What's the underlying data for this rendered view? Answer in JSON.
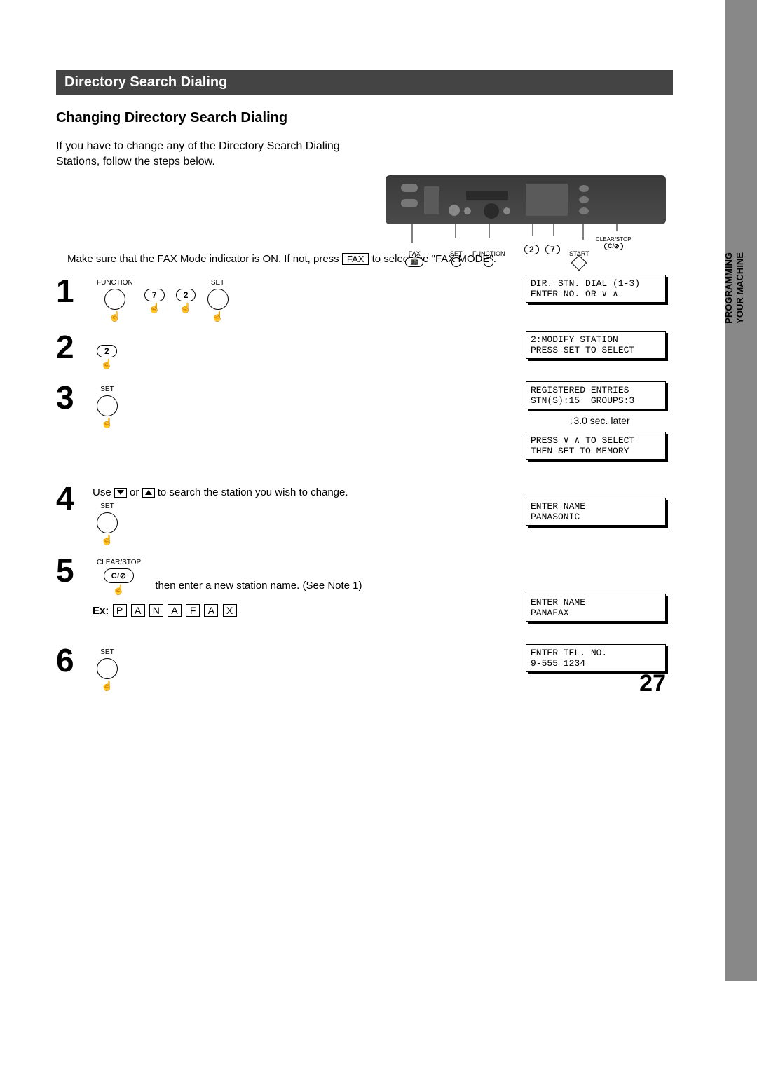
{
  "side_tab": {
    "line1": "PROGRAMMING",
    "line2": "YOUR MACHINE"
  },
  "section_header": "Directory Search Dialing",
  "subheading": "Changing Directory Search Dialing",
  "intro": "If you have to change any of the Directory Search Dialing Stations, follow the steps below.",
  "device_callouts": {
    "fax": "FAX",
    "set": "SET",
    "function": "FUNCTION",
    "two": "2",
    "seven": "7",
    "start": "START",
    "clearstop": "CLEAR/STOP",
    "clearbtn": "C/⊘"
  },
  "mode_line_pre": "Make sure that the FAX Mode indicator is ON.  If not, press ",
  "mode_line_key": "FAX",
  "mode_line_post": " to select the \"FAX MODE\".",
  "buttons": {
    "function_label": "FUNCTION",
    "set_label": "SET",
    "clearstop_label": "CLEAR/STOP",
    "seven": "7",
    "two": "2",
    "clearstop_btn": "C/⊘"
  },
  "steps": {
    "s1": {
      "num": "1",
      "lcd1": "DIR. STN. DIAL (1-3)\nENTER NO. OR ∨ ∧"
    },
    "s2": {
      "num": "2",
      "lcd1": "2:MODIFY STATION\nPRESS SET TO SELECT"
    },
    "s3": {
      "num": "3",
      "lcd1": "REGISTERED ENTRIES\nSTN(S):15  GROUPS:3",
      "delay": "↓3.0 sec. later",
      "lcd2": "PRESS ∨ ∧ TO SELECT\nTHEN SET TO MEMORY"
    },
    "s4": {
      "num": "4",
      "text_pre": "Use ",
      "text_mid": " or ",
      "text_post": " to search the station you wish to change.",
      "lcd1": "ENTER NAME\nPANASONIC"
    },
    "s5": {
      "num": "5",
      "text": "then enter a new station name. (See Note 1)",
      "ex_label": "Ex:",
      "ex_chars": [
        "P",
        "A",
        "N",
        "A",
        "F",
        "A",
        "X"
      ],
      "lcd1": "ENTER NAME\nPANAFAX"
    },
    "s6": {
      "num": "6",
      "lcd1": "ENTER TEL. NO.\n9-555 1234"
    }
  },
  "page_number": "27"
}
